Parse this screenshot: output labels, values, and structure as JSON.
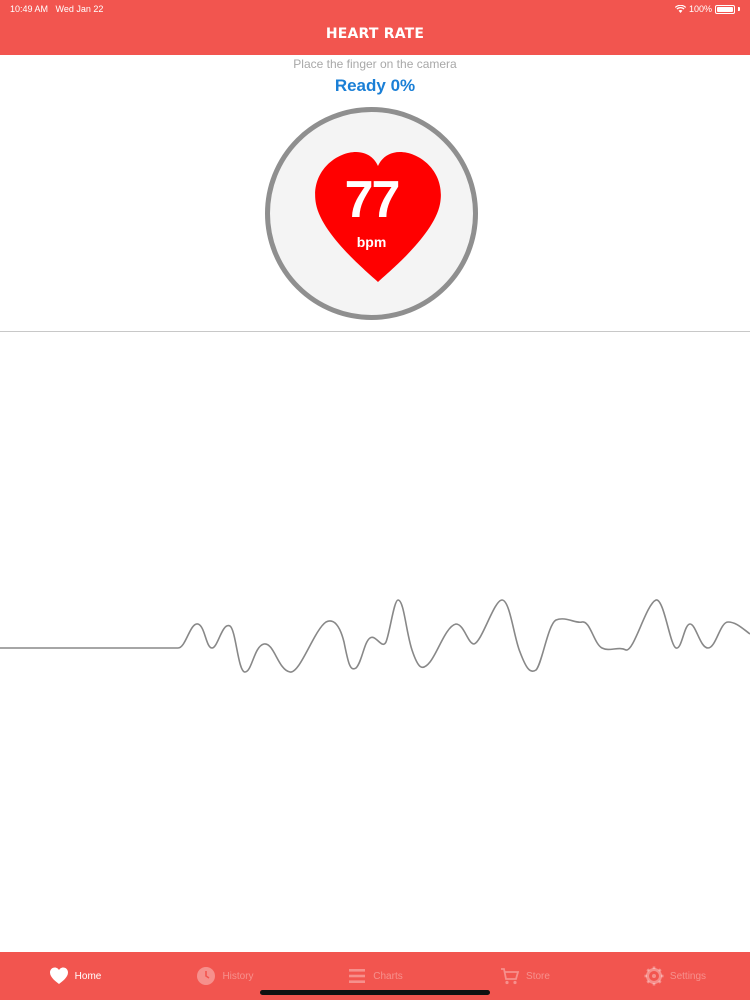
{
  "status_bar": {
    "time": "10:49 AM",
    "date": "Wed Jan 22",
    "battery": "100%"
  },
  "header": {
    "title": "HEART RATE"
  },
  "measure": {
    "instruction": "Place the finger on the camera",
    "status": "Ready 0%",
    "bpm": "77",
    "unit": "bpm"
  },
  "colors": {
    "brand": "#f2554f",
    "heart": "#ff0000",
    "status_text": "#1a7fd6",
    "ring": "#8f8f8f"
  },
  "tabs": [
    {
      "label": "Home",
      "icon": "heart-icon",
      "active": true
    },
    {
      "label": "History",
      "icon": "history-icon",
      "active": false
    },
    {
      "label": "Charts",
      "icon": "list-icon",
      "active": false
    },
    {
      "label": "Store",
      "icon": "cart-icon",
      "active": false
    },
    {
      "label": "Settings",
      "icon": "gear-icon",
      "active": false
    }
  ]
}
